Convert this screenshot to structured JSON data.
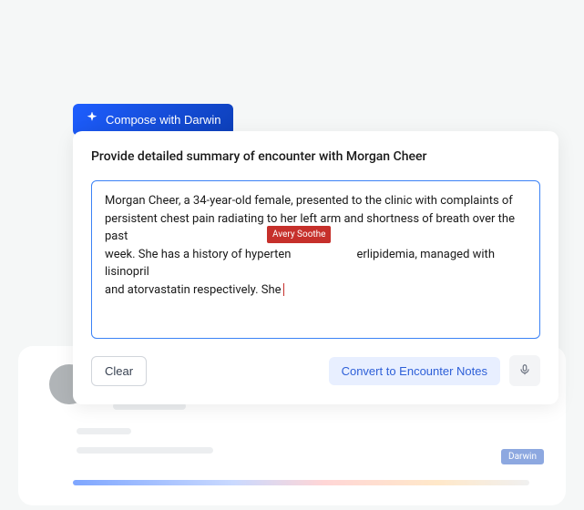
{
  "compose_button": {
    "label": "Compose with Darwin"
  },
  "card": {
    "title": "Provide detailed summary of encounter with Morgan Cheer"
  },
  "encounter_text": {
    "line1": "Morgan Cheer, a 34-year-old female, presented to the clinic with complaints of",
    "line2": "persistent chest pain radiating to her left arm and shortness of breath over the past",
    "line3_a": "week. She has a history of hyperten",
    "line3_b": "erlipidemia, managed with lisinopril",
    "line4": "and atorvastatin respectively. She"
  },
  "collab": {
    "user_tag": "Avery Soothe",
    "assistant_tag": "Darwin"
  },
  "footer": {
    "clear_label": "Clear",
    "convert_label": "Convert to Encounter Notes"
  }
}
